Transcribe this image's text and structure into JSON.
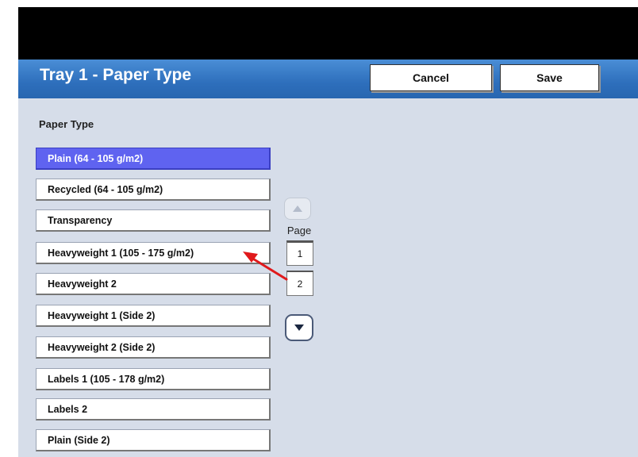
{
  "header": {
    "title": "Tray 1 - Paper Type",
    "cancel_label": "Cancel",
    "save_label": "Save"
  },
  "list": {
    "label": "Paper Type",
    "items": [
      {
        "label": "Plain (64 - 105 g/m2)",
        "selected": true
      },
      {
        "label": "Recycled (64 - 105 g/m2)",
        "selected": false
      },
      {
        "label": "Transparency",
        "selected": false
      },
      {
        "label": "Heavyweight 1 (105 - 175 g/m2)",
        "selected": false
      },
      {
        "label": "Heavyweight 2",
        "selected": false
      },
      {
        "label": "Heavyweight 1 (Side 2)",
        "selected": false
      },
      {
        "label": "Heavyweight 2 (Side 2)",
        "selected": false
      },
      {
        "label": "Labels 1 (105 - 178 g/m2)",
        "selected": false
      },
      {
        "label": "Labels 2",
        "selected": false
      },
      {
        "label": "Plain (Side 2)",
        "selected": false
      }
    ]
  },
  "pager": {
    "label": "Page",
    "pages": [
      "1",
      "2"
    ]
  },
  "colors": {
    "title_bar": "#2e6fbc",
    "selected_item": "#5f63f0",
    "annotation_arrow": "#e0191b",
    "background": "#d6dde9"
  },
  "icons": {
    "up": "triangle-up-icon",
    "down": "triangle-down-icon",
    "annotation": "red-arrow-icon"
  }
}
